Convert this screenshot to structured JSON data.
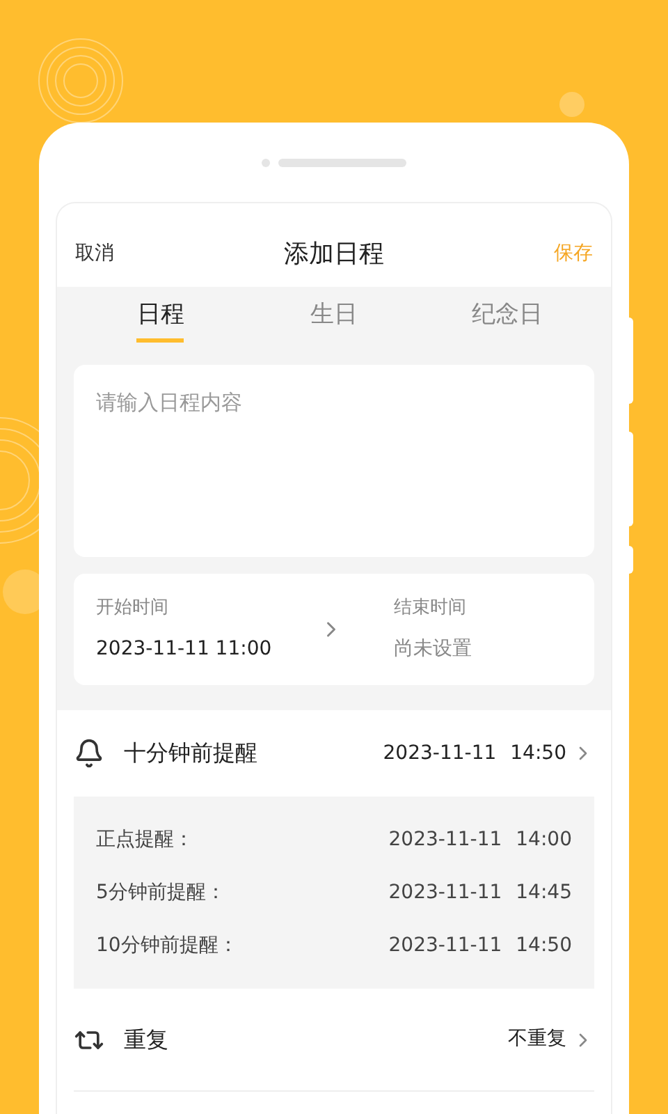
{
  "header": {
    "cancel": "取消",
    "title": "添加日程",
    "save": "保存"
  },
  "tabs": [
    {
      "label": "日程",
      "selected": true
    },
    {
      "label": "生日",
      "selected": false
    },
    {
      "label": "纪念日",
      "selected": false
    }
  ],
  "content": {
    "placeholder": "请输入日程内容"
  },
  "time": {
    "start_label": "开始时间",
    "start_value": "2023-11-11 11:00",
    "end_label": "结束时间",
    "end_value": "尚未设置"
  },
  "reminder": {
    "label": "十分钟前提醒",
    "date": "2023-11-11",
    "time": "14:50",
    "options": [
      {
        "label": "正点提醒：",
        "date": "2023-11-11",
        "time": "14:00"
      },
      {
        "label": "5分钟前提醒：",
        "date": "2023-11-11",
        "time": "14:45"
      },
      {
        "label": "10分钟前提醒：",
        "date": "2023-11-11",
        "time": "14:50"
      }
    ]
  },
  "repeat": {
    "label": "重复",
    "value": "不重复"
  }
}
